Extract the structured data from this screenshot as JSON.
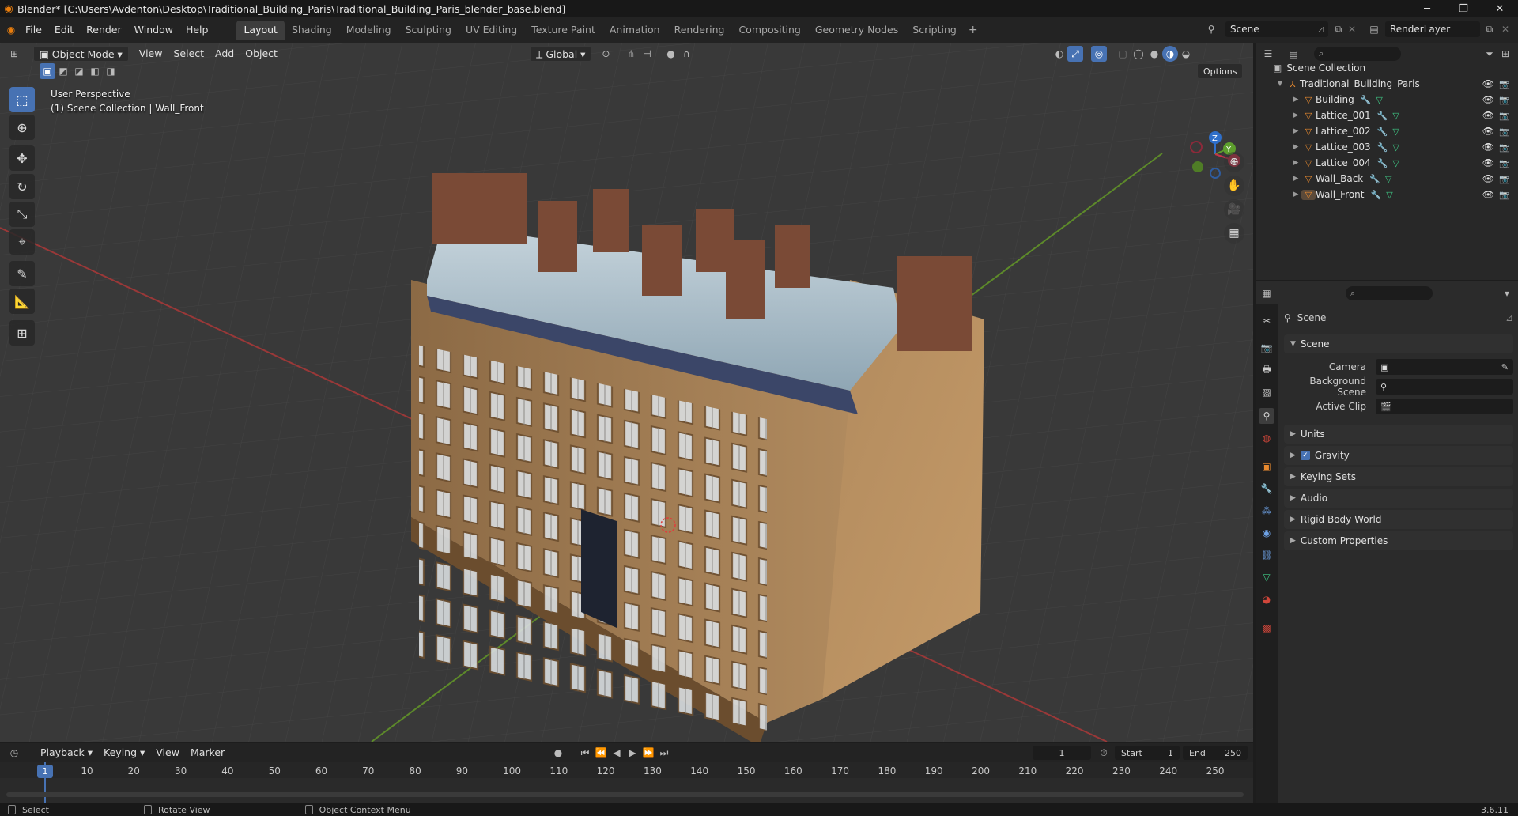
{
  "titlebar": {
    "title": "Blender* [C:\\Users\\Avdenton\\Desktop\\Traditional_Building_Paris\\Traditional_Building_Paris_blender_base.blend]",
    "minimize": "─",
    "maximize": "❐",
    "close": "✕"
  },
  "menu": [
    "File",
    "Edit",
    "Render",
    "Window",
    "Help"
  ],
  "workspaces": [
    "Layout",
    "Shading",
    "Modeling",
    "Sculpting",
    "UV Editing",
    "Texture Paint",
    "Animation",
    "Rendering",
    "Compositing",
    "Geometry Nodes",
    "Scripting"
  ],
  "workspace_add": "+",
  "scene_selector": {
    "value": "Scene"
  },
  "view_layer_selector": {
    "value": "RenderLayer"
  },
  "viewport_header": {
    "mode": "Object Mode",
    "menus": [
      "View",
      "Select",
      "Add",
      "Object"
    ],
    "transform_orientation": "Global",
    "options": "Options"
  },
  "viewport_info": {
    "view_name": "User Perspective",
    "context": "(1) Scene Collection | Wall_Front"
  },
  "gizmo": {
    "z": "Z",
    "y": "Y",
    "x": "X"
  },
  "outliner": {
    "root": "Scene Collection",
    "collection": "Traditional_Building_Paris",
    "objects": [
      {
        "name": "Building"
      },
      {
        "name": "Lattice_001"
      },
      {
        "name": "Lattice_002"
      },
      {
        "name": "Lattice_003"
      },
      {
        "name": "Lattice_004"
      },
      {
        "name": "Wall_Back"
      },
      {
        "name": "Wall_Front"
      }
    ]
  },
  "properties": {
    "context_title": "Scene",
    "scene_panel": "Scene",
    "fields": [
      {
        "label": "Camera",
        "value": ""
      },
      {
        "label": "Background Scene",
        "value": ""
      },
      {
        "label": "Active Clip",
        "value": ""
      }
    ],
    "collapsed_panels": [
      "Units",
      "Gravity",
      "Keying Sets",
      "Audio",
      "Rigid Body World",
      "Custom Properties"
    ]
  },
  "timeline": {
    "menus": [
      "Playback",
      "Keying",
      "View",
      "Marker"
    ],
    "current_frame": "1",
    "start_label": "Start",
    "start": "1",
    "end_label": "End",
    "end": "250",
    "ticks": [
      "10",
      "20",
      "30",
      "40",
      "50",
      "60",
      "70",
      "80",
      "90",
      "100",
      "110",
      "120",
      "130",
      "140",
      "150",
      "160",
      "170",
      "180",
      "190",
      "200",
      "210",
      "220",
      "230",
      "240",
      "250"
    ],
    "playhead_label": "1"
  },
  "statusbar": {
    "select": "Select",
    "rotate": "Rotate View",
    "context_menu": "Object Context Menu",
    "version": "3.6.11"
  },
  "colors": {
    "accent": "#4772b3",
    "object_orange": "#e88a2f",
    "mesh_green": "#3fc986",
    "modifier_blue": "#6ea2e6"
  }
}
